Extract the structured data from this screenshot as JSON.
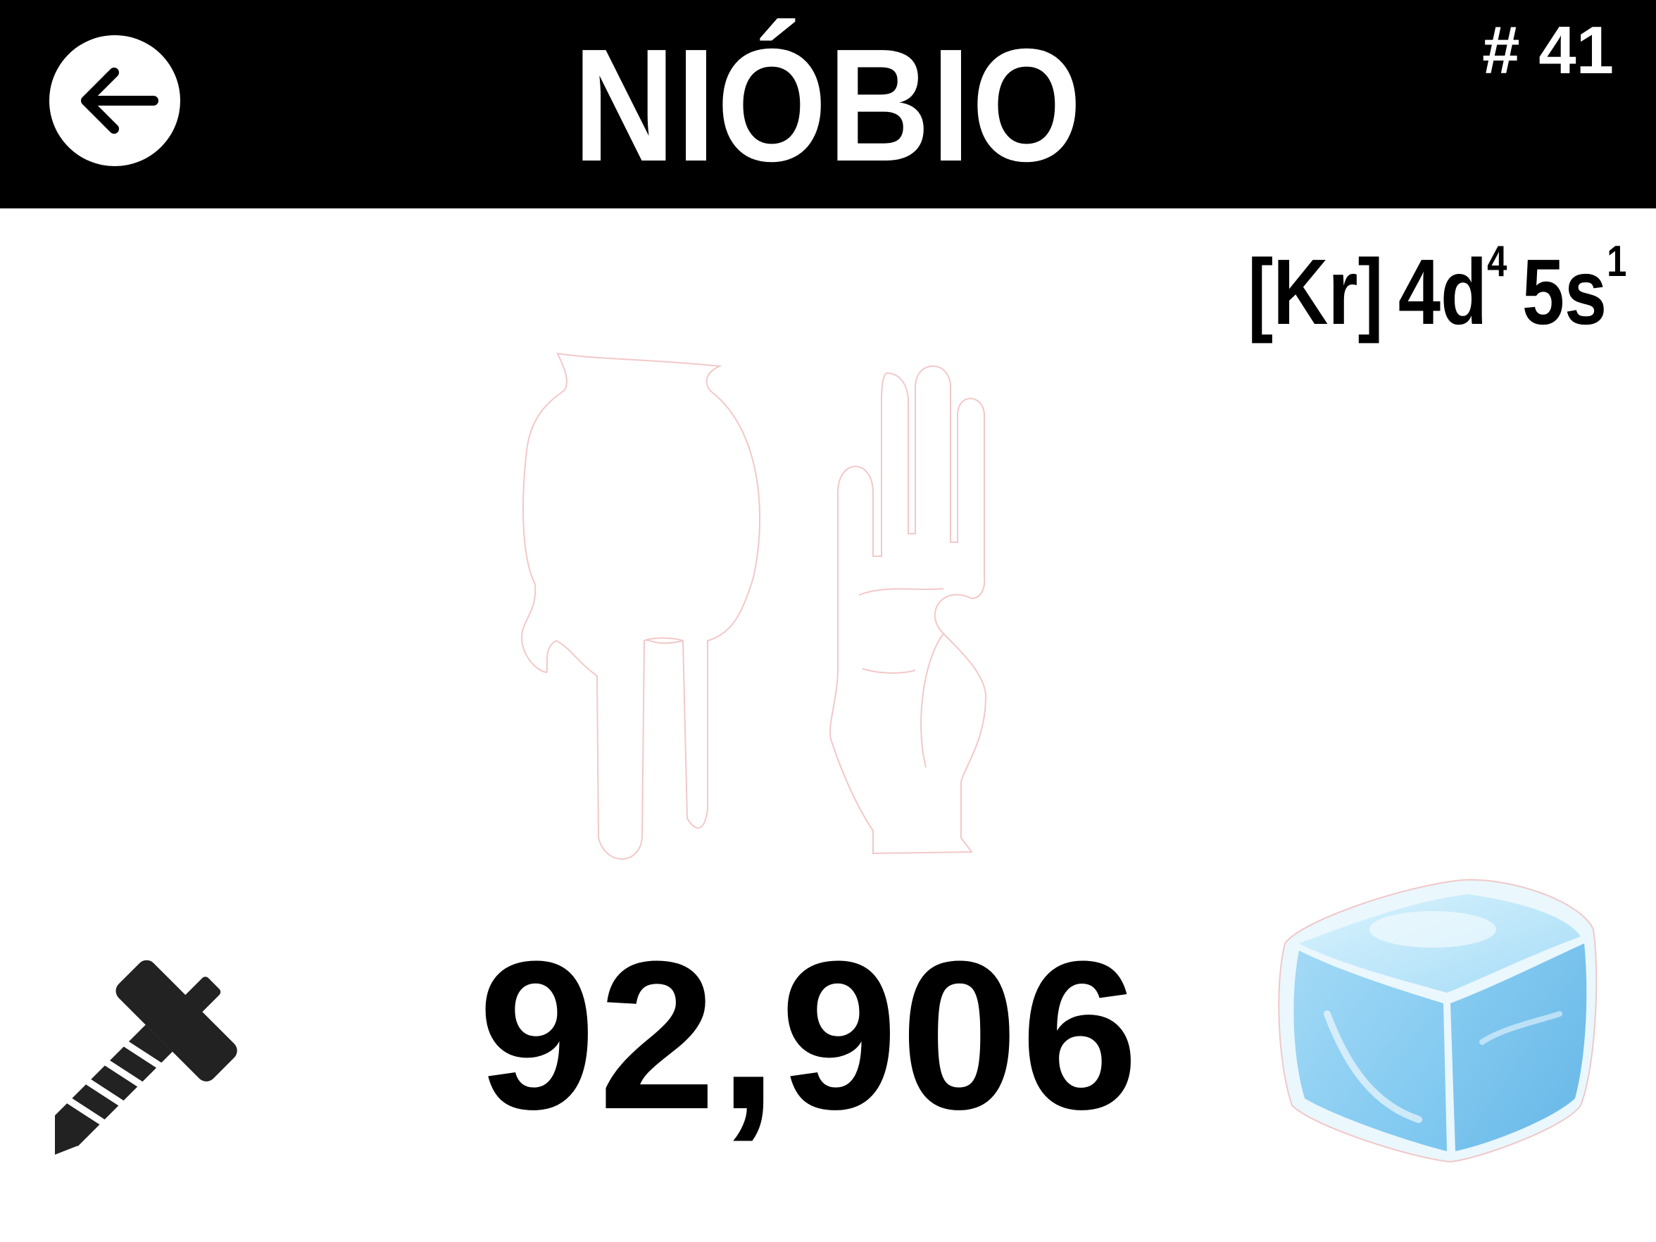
{
  "header": {
    "title": "NIÓBIO",
    "element_number": "# 41",
    "background_color": "#000000",
    "text_color": "#ffffff",
    "back_icon": "arrow-left-icon"
  },
  "electron_configuration": {
    "core": "[Kr]",
    "orbitals": [
      {
        "orbital": "4d",
        "electrons": "4"
      },
      {
        "orbital": "5s",
        "electrons": "1"
      }
    ]
  },
  "hand_signs": {
    "icons": [
      "hand-pointing-down-icon",
      "hand-three-fingers-icon"
    ],
    "outline_color": "#f2c8c8"
  },
  "atomic_mass": "92,906",
  "icons": {
    "material": "screw-icon",
    "state": "ice-cube-icon"
  },
  "colors": {
    "ice_light": "#cdeefc",
    "ice_mid": "#8fd0f4",
    "ice_dark": "#5bb3e8"
  }
}
